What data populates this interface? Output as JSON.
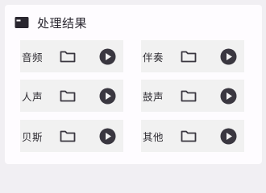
{
  "panel": {
    "title": "处理结果"
  },
  "tiles": [
    {
      "label": "音频"
    },
    {
      "label": "伴奏"
    },
    {
      "label": "人声"
    },
    {
      "label": "鼓声"
    },
    {
      "label": "贝斯"
    },
    {
      "label": "其他"
    }
  ],
  "icons": {
    "header": "folder-filled-icon",
    "folder": "folder-outline-icon",
    "play": "play-circle-icon"
  },
  "colors": {
    "icon": "#3a3740",
    "card": "#fefcff",
    "tile": "#f1f1f1",
    "background": "#f1eff3"
  }
}
